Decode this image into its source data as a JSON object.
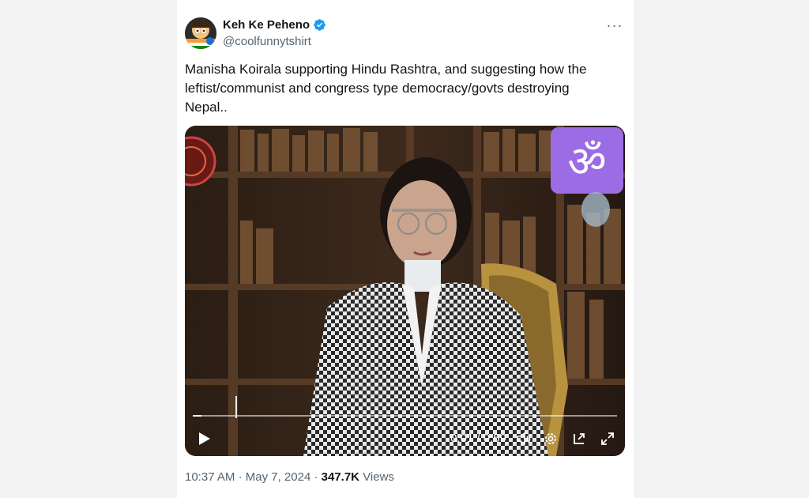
{
  "author": {
    "display_name": "Keh Ke Peheno",
    "handle": "@coolfunnytshirt"
  },
  "tweet": {
    "text": "Manisha Koirala supporting Hindu Rashtra, and suggesting how the leftist/communist and congress type democracy/govts destroying Nepal.."
  },
  "video": {
    "time": "0:01 / 0:59",
    "progress_fraction": 0.02,
    "overlay_symbol": "ॐ"
  },
  "meta": {
    "time": "10:37 AM",
    "date": "May 7, 2024",
    "separator": "·",
    "views_count": "347.7K",
    "views_label": "Views"
  },
  "colors": {
    "verified": "#1d9bf0",
    "om_badge": "#9b6ce3"
  }
}
